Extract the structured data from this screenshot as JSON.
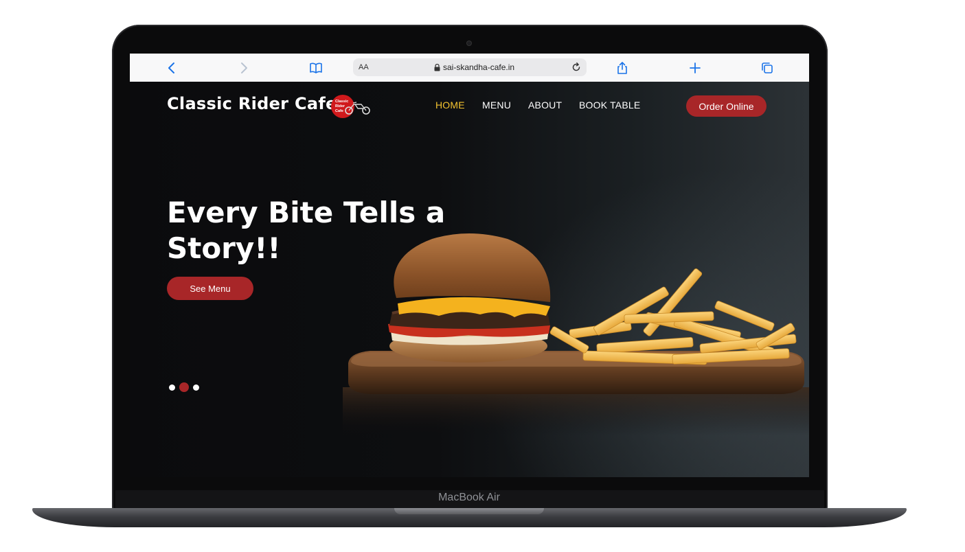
{
  "device": {
    "label": "MacBook Air"
  },
  "browser": {
    "address": {
      "reader_label": "AA",
      "url": "sai-skandha-cafe.in"
    }
  },
  "site": {
    "brand": "Classic Rider Cafe",
    "badge_lines": [
      "Classic",
      "Rider",
      "Cafe"
    ],
    "nav": [
      {
        "label": "HOME",
        "active": true
      },
      {
        "label": "MENU"
      },
      {
        "label": "ABOUT"
      },
      {
        "label": "BOOK TABLE"
      }
    ],
    "order_button": "Order Online",
    "hero": {
      "title_line1": "Every Bite Tells a",
      "title_line2": "Story!!",
      "cta": "See Menu"
    },
    "slider": {
      "count": 3,
      "active_index": 1
    }
  },
  "colors": {
    "accent": "#a82628",
    "nav_active": "#f4c430",
    "safari_blue": "#1a73e8"
  }
}
